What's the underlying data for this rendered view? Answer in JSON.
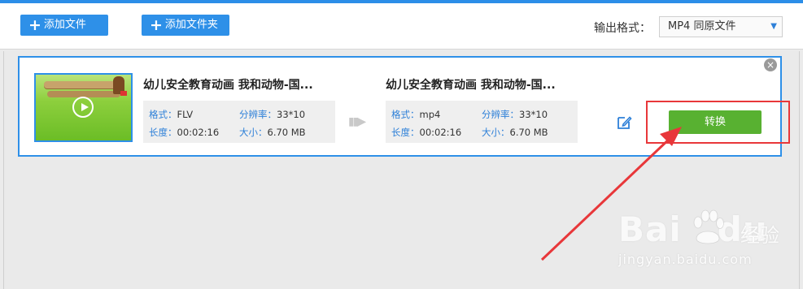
{
  "toolbar": {
    "add_file_label": "添加文件",
    "add_folder_label": "添加文件夹",
    "output_format_label": "输出格式：",
    "output_format_value": "MP4  同原文件"
  },
  "file": {
    "source": {
      "name": "幼儿安全教育动画 我和动物-国...",
      "format_key": "格式：",
      "format_value": "FLV",
      "resolution_key": "分辨率：",
      "resolution_value": "33*10",
      "duration_key": "长度：",
      "duration_value": "00:02:16",
      "size_key": "大小：",
      "size_value": "6.70 MB"
    },
    "target": {
      "name": "幼儿安全教育动画 我和动物-国...",
      "format_key": "格式：",
      "format_value": "mp4",
      "resolution_key": "分辨率：",
      "resolution_value": "33*10",
      "duration_key": "长度：",
      "duration_value": "00:02:16",
      "size_key": "大小：",
      "size_value": "6.70 MB"
    },
    "convert_label": "转换",
    "close_glyph": "×",
    "arrow_glyph": "▮▮▶"
  },
  "watermark": {
    "brand": "Bai",
    "brand_tail": "du",
    "chinese": "经验",
    "site": "jingyan.baidu.com"
  },
  "colors": {
    "accent_blue": "#2e90e8",
    "convert_green": "#58b131",
    "annotation_red": "#e8373a"
  },
  "icons": [
    "plus-icon",
    "dropdown-caret-icon",
    "close-icon",
    "play-icon",
    "arrow-right-icon",
    "edit-icon"
  ]
}
